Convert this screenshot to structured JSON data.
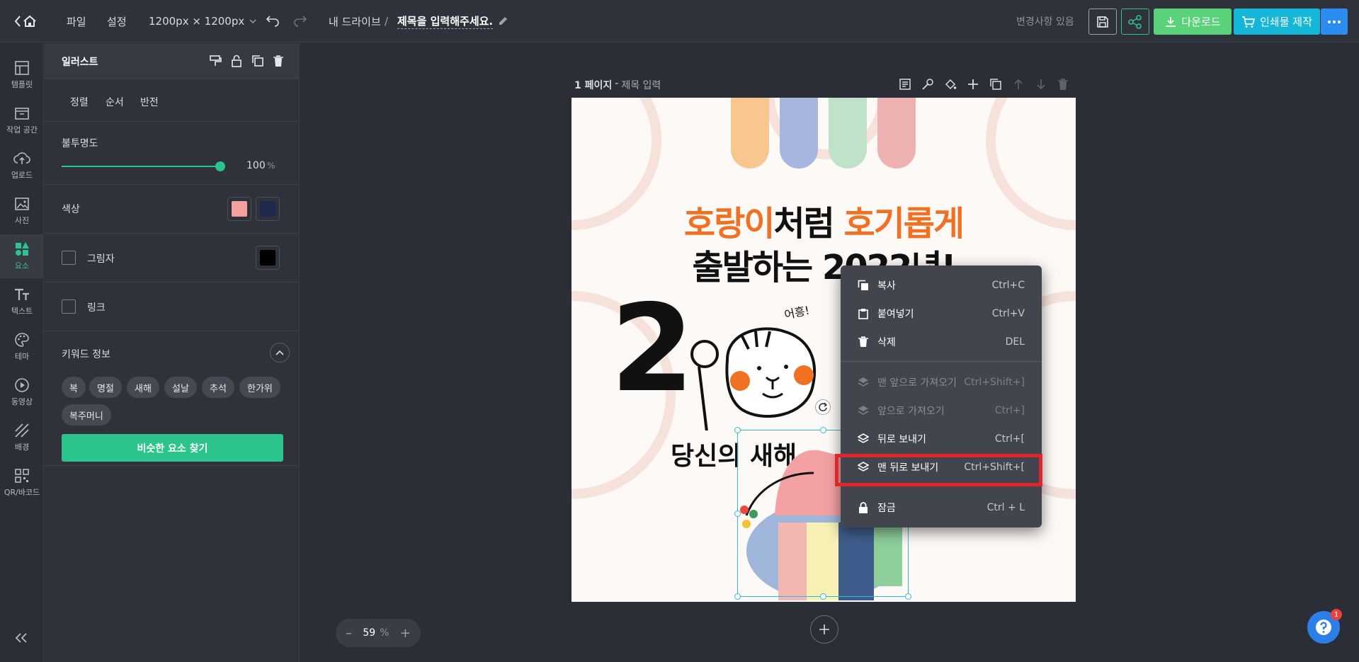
{
  "header": {
    "file_menu": "파일",
    "settings_menu": "설정",
    "size": "1200px × 1200px",
    "breadcrumb_root": "내 드라이브",
    "breadcrumb_sep": "/",
    "doc_title": "제목을 입력해주세요.",
    "status": "변경사항 있음",
    "download": "다운로드",
    "print": "인쇄물 제작"
  },
  "rail": {
    "items": [
      {
        "label": "템플릿"
      },
      {
        "label": "작업 공간"
      },
      {
        "label": "업로드"
      },
      {
        "label": "사진"
      },
      {
        "label": "요소"
      },
      {
        "label": "텍스트"
      },
      {
        "label": "테마"
      },
      {
        "label": "동영상"
      },
      {
        "label": "배경"
      },
      {
        "label": "QR/바코드"
      }
    ]
  },
  "panel": {
    "title": "일러스트",
    "tabs": [
      "정렬",
      "순서",
      "반전"
    ],
    "opacity_label": "불투명도",
    "opacity_value": "100",
    "opacity_unit": "%",
    "opacity": 1.0,
    "color_label": "색상",
    "colors": [
      "#f4a09c",
      "#1e2a4d"
    ],
    "shadow_label": "그림자",
    "shadow_color": "#000000",
    "link_label": "링크",
    "keyword_label": "키워드 정보",
    "keywords": [
      "복",
      "명절",
      "새해",
      "설날",
      "추석",
      "한가위",
      "복주머니"
    ],
    "find_similar": "비슷한 요소 찾기"
  },
  "page": {
    "number": "1 페이지",
    "sep": "-",
    "title_placeholder": "제목 입력"
  },
  "canvas": {
    "headline_orange_1": "호랑이",
    "headline_black_1": "처럼 ",
    "headline_orange_2": "호기롭게",
    "headline_line2": "출발하는 2022년!",
    "big_digit": "2",
    "tiger_text": "어흥!",
    "subline": "당신의 새해"
  },
  "context_menu": {
    "items": [
      {
        "label": "복사",
        "shortcut": "Ctrl+C",
        "icon": "copy-icon"
      },
      {
        "label": "붙여넣기",
        "shortcut": "Ctrl+V",
        "icon": "paste-icon"
      },
      {
        "label": "삭제",
        "shortcut": "DEL",
        "icon": "trash-icon"
      },
      {
        "label": "맨 앞으로 가져오기",
        "shortcut": "Ctrl+Shift+]",
        "icon": "layers-icon"
      },
      {
        "label": "앞으로 가져오기",
        "shortcut": "Ctrl+]",
        "icon": "layers-icon"
      },
      {
        "label": "뒤로 보내기",
        "shortcut": "Ctrl+[",
        "icon": "layers-icon"
      },
      {
        "label": "맨 뒤로 보내기",
        "shortcut": "Ctrl+Shift+[",
        "icon": "layers-icon"
      },
      {
        "label": "잠금",
        "shortcut": "Ctrl + L",
        "icon": "lock-icon"
      }
    ]
  },
  "zoom": {
    "value": "59",
    "unit": "%"
  },
  "help": {
    "badge": "1"
  },
  "colors": {
    "accent": "#2bc48a",
    "download_green": "#5ad27a",
    "print_cyan": "#14b7d7",
    "more_blue": "#2d8cf0",
    "highlight": "#e0262a",
    "orange": "#f27022"
  }
}
